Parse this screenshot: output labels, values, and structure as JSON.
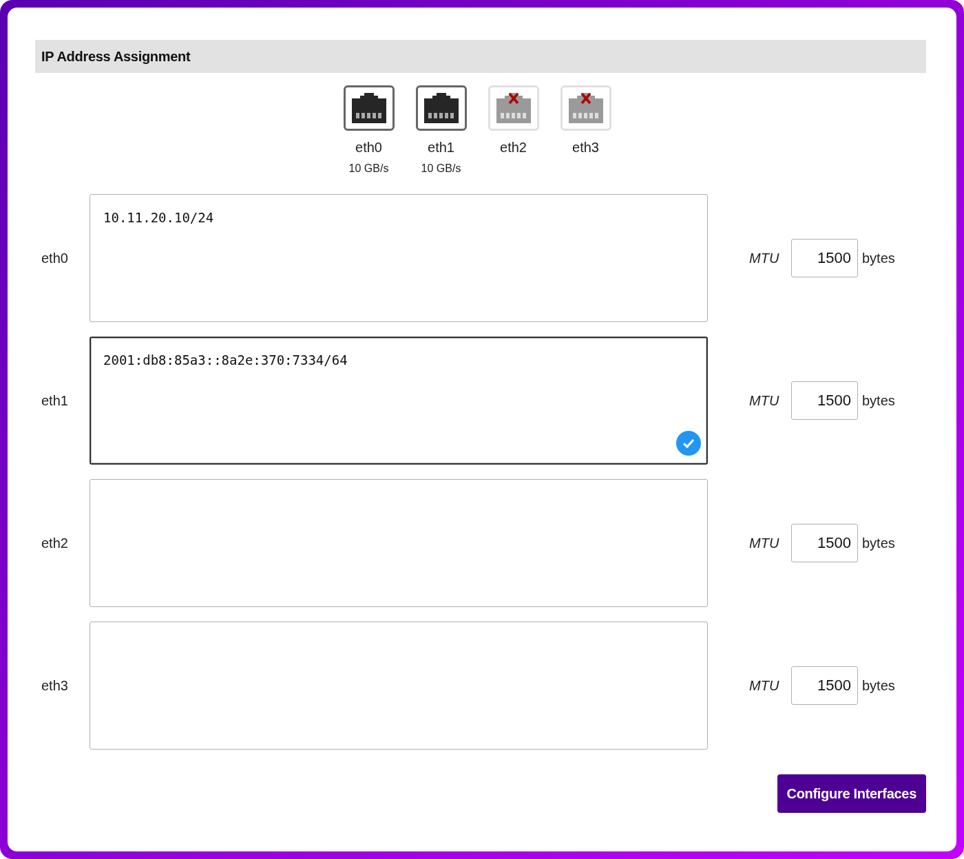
{
  "section": {
    "title": "IP Address Assignment"
  },
  "ports": [
    {
      "name": "eth0",
      "speed": "10 GB/s",
      "connected": true
    },
    {
      "name": "eth1",
      "speed": "10 GB/s",
      "connected": true
    },
    {
      "name": "eth2",
      "connected": false
    },
    {
      "name": "eth3",
      "connected": false
    }
  ],
  "interfaces": [
    {
      "label": "eth0",
      "value": "10.11.20.10/24",
      "focused": false,
      "mtu_label": "MTU",
      "mtu": "1500",
      "unit": "bytes"
    },
    {
      "label": "eth1",
      "value": "2001:db8:85a3::8a2e:370:7334/64",
      "focused": true,
      "mtu_label": "MTU",
      "mtu": "1500",
      "unit": "bytes"
    },
    {
      "label": "eth2",
      "focused": false,
      "mtu_label": "MTU",
      "mtu": "1500",
      "unit": "bytes"
    },
    {
      "label": "eth3",
      "focused": false,
      "mtu_label": "MTU",
      "mtu": "1500",
      "unit": "bytes"
    }
  ],
  "button": {
    "label": "Configure Interfaces"
  }
}
